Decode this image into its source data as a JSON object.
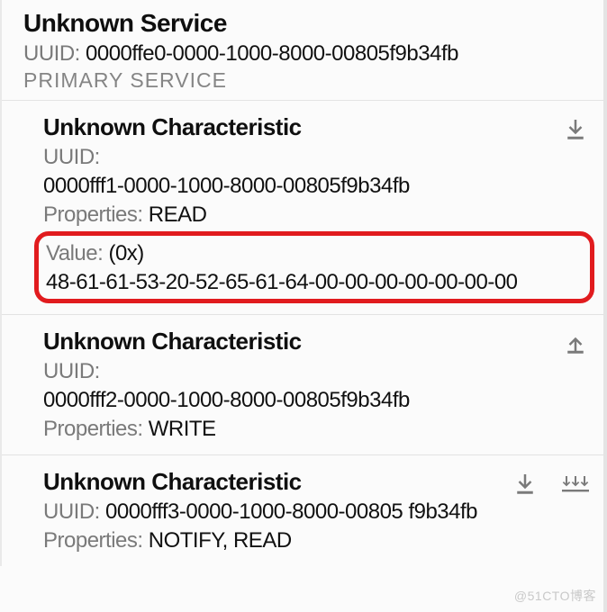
{
  "service": {
    "title": "Unknown Service",
    "uuid_label": "UUID:",
    "uuid_value": "0000ffe0-0000-1000-8000-00805f9b34fb",
    "tag": "PRIMARY SERVICE"
  },
  "characteristics": [
    {
      "title": "Unknown Characteristic",
      "uuid_label": "UUID:",
      "uuid_value": "0000fff1-0000-1000-8000-00805f9b34fb",
      "props_label": "Properties:",
      "props_value": "READ",
      "value_label": "Value:",
      "value_prefix": "(0x)",
      "value_hex": "48-61-61-53-20-52-65-61-64-00-00-00-00-00-00-00"
    },
    {
      "title": "Unknown Characteristic",
      "uuid_label": "UUID:",
      "uuid_value": "0000fff2-0000-1000-8000-00805f9b34fb",
      "props_label": "Properties:",
      "props_value": "WRITE"
    },
    {
      "title": "Unknown Characteristic",
      "uuid_label": "UUID:",
      "uuid_value": "0000fff3-0000-1000-8000-00805 f9b34fb",
      "props_label": "Properties:",
      "props_value": "NOTIFY, READ"
    }
  ],
  "watermark": "@51CTO博客"
}
